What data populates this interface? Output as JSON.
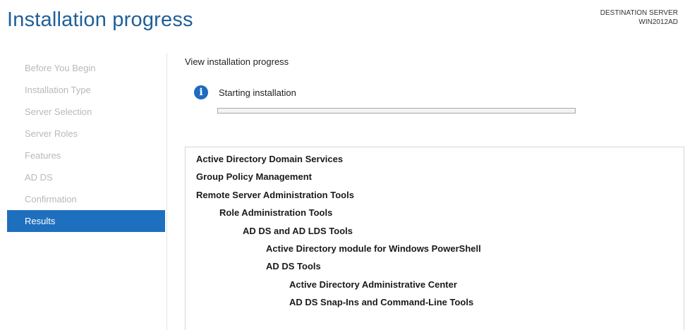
{
  "header": {
    "title": "Installation progress",
    "destination_label": "DESTINATION SERVER",
    "destination_name": "WIN2012AD"
  },
  "nav": {
    "items": [
      {
        "label": "Before You Begin",
        "selected": false
      },
      {
        "label": "Installation Type",
        "selected": false
      },
      {
        "label": "Server Selection",
        "selected": false
      },
      {
        "label": "Server Roles",
        "selected": false
      },
      {
        "label": "Features",
        "selected": false
      },
      {
        "label": "AD DS",
        "selected": false
      },
      {
        "label": "Confirmation",
        "selected": false
      },
      {
        "label": "Results",
        "selected": true
      }
    ],
    "selected_color": "#1f6fbf"
  },
  "main": {
    "heading": "View installation progress",
    "status_icon": "info-icon",
    "status_text": "Starting installation",
    "progress_fraction": 0,
    "features": [
      {
        "label": "Active Directory Domain Services",
        "level": 0
      },
      {
        "label": "Group Policy Management",
        "level": 0
      },
      {
        "label": "Remote Server Administration Tools",
        "level": 0
      },
      {
        "label": "Role Administration Tools",
        "level": 1
      },
      {
        "label": "AD DS and AD LDS Tools",
        "level": 2
      },
      {
        "label": "Active Directory module for Windows PowerShell",
        "level": 3
      },
      {
        "label": "AD DS Tools",
        "level": 3
      },
      {
        "label": "Active Directory Administrative Center",
        "level": 4
      },
      {
        "label": "AD DS Snap-Ins and Command-Line Tools",
        "level": 4
      }
    ]
  },
  "colors": {
    "title": "#1f5f98",
    "info_icon": "#1e6bbf",
    "nav_inactive_text": "#b9b9b9"
  }
}
